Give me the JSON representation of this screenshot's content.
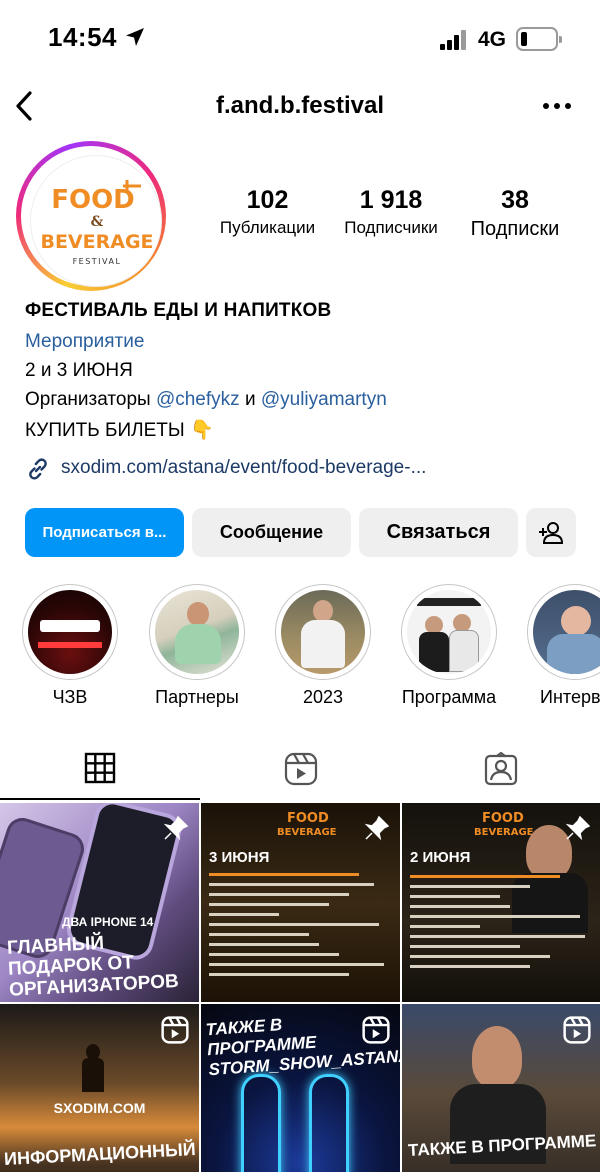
{
  "status_bar": {
    "time": "14:54",
    "network": "4G"
  },
  "header": {
    "username": "f.and.b.festival"
  },
  "avatar": {
    "logo_text_top": "FOOD",
    "logo_amp": "&",
    "logo_text_mid": "BEVERAGE",
    "logo_text_bottom": "FESTIVAL"
  },
  "stats": [
    {
      "value": "102",
      "label": "Публикации"
    },
    {
      "value": "1 918",
      "label": "Подписчики"
    },
    {
      "value": "38",
      "label": "Подписки"
    }
  ],
  "bio": {
    "name": "ФЕСТИВАЛЬ ЕДЫ И НАПИТКОВ",
    "category": "Мероприятие",
    "line1": "2 и 3 ИЮНЯ",
    "organizers_prefix": "Организаторы",
    "mention1": "@chefykz",
    "conj": "и",
    "mention2": "@yuliyamartyn",
    "line3": "КУПИТЬ БИЛЕТЫ 👇",
    "link": "sxodim.com/astana/event/food-beverage-..."
  },
  "buttons": {
    "follow": "Подписаться в...",
    "message": "Сообщение",
    "contact": "Связаться"
  },
  "highlights": [
    {
      "label": "ЧЗВ"
    },
    {
      "label": "Партнеры"
    },
    {
      "label": "2023"
    },
    {
      "label": "Программа"
    },
    {
      "label": "Интервь"
    }
  ],
  "posts": [
    {
      "title": "ГЛАВНЫЙ ПОДАРОК ОТ ОРГАНИЗАТОРОВ",
      "subtitle": "ДВА IPHONE 14",
      "badge": "pin"
    },
    {
      "title": "3 ИЮНЯ",
      "badge": "pin"
    },
    {
      "title": "2 ИЮНЯ",
      "badge": "pin"
    },
    {
      "title": "ИНФОРМАЦИОННЫЙ",
      "subtitle": "SXODIM.COM",
      "badge": "reel"
    },
    {
      "title": "ТАКЖЕ В ПРОГРАММЕ STORM_SHOW_ASTANA",
      "badge": "reel"
    },
    {
      "title": "ТАКЖЕ В ПРОГРАММЕ",
      "badge": "reel"
    }
  ],
  "colors": {
    "link_blue": "#2a5f9e",
    "follow_button": "#0095f6",
    "button_gray": "#efefef"
  }
}
